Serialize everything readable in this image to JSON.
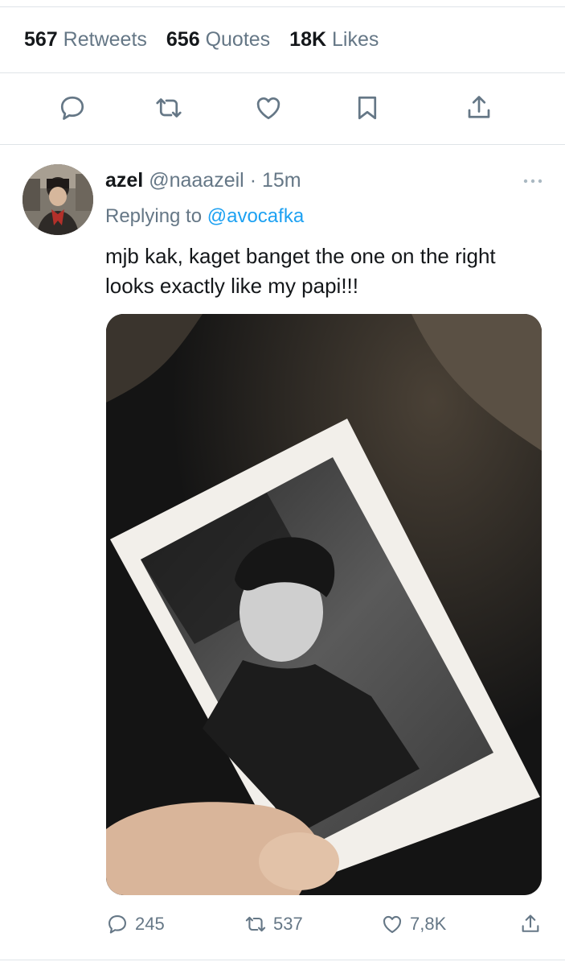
{
  "stats": {
    "retweets": {
      "count": "567",
      "label": "Retweets"
    },
    "quotes": {
      "count": "656",
      "label": "Quotes"
    },
    "likes": {
      "count": "18K",
      "label": "Likes"
    }
  },
  "reply_tweet": {
    "name": "azel",
    "handle": "@naaazeil",
    "separator": "·",
    "time": "15m",
    "replying_prefix": "Replying to",
    "replying_to": "@avocafka",
    "text": "mjb kak, kaget banget the one on the right looks exactly like my papi!!!",
    "counts": {
      "replies": "245",
      "retweets": "537",
      "likes": "7,8K"
    }
  },
  "colors": {
    "accent": "#1da1f2",
    "muted": "#657786",
    "text": "#14171a",
    "divider": "#dfe4e8"
  },
  "icons": [
    "reply-icon",
    "retweet-icon",
    "like-icon",
    "bookmark-icon",
    "share-icon",
    "more-icon"
  ]
}
